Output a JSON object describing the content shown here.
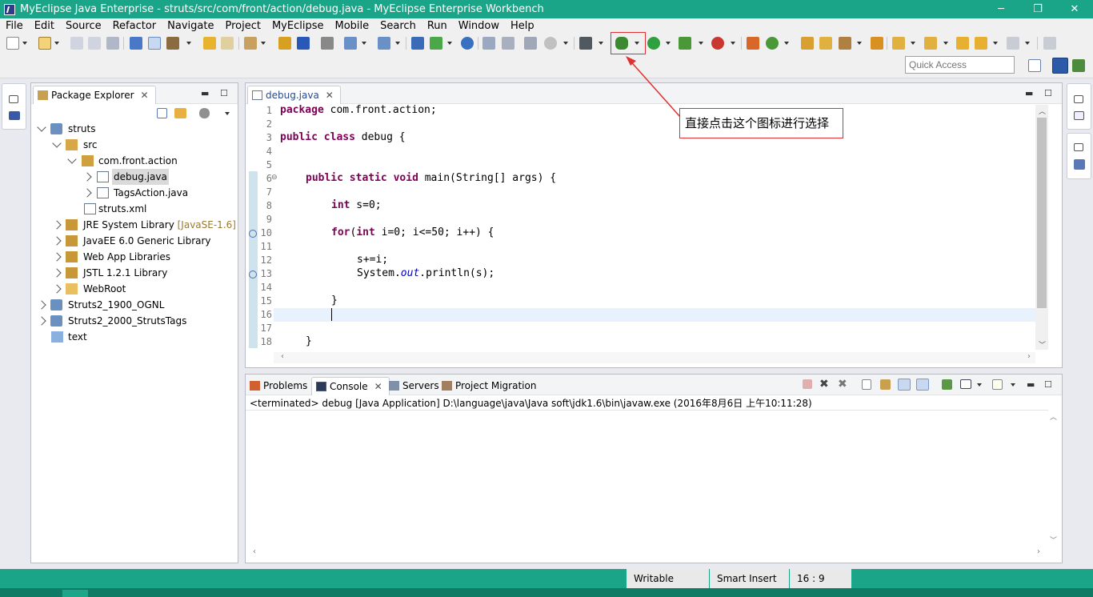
{
  "window": {
    "title": "MyEclipse Java Enterprise - struts/src/com/front/action/debug.java - MyEclipse Enterprise Workbench",
    "minimize": "─",
    "maximize": "❐",
    "close": "✕"
  },
  "menu": [
    "File",
    "Edit",
    "Source",
    "Refactor",
    "Navigate",
    "Project",
    "MyEclipse",
    "Mobile",
    "Search",
    "Run",
    "Window",
    "Help"
  ],
  "toolbar": {
    "quick_access_placeholder": "Quick Access"
  },
  "package_explorer": {
    "tab_label": "Package Explorer",
    "tree": [
      {
        "label": "struts",
        "icon": "project-icon"
      },
      {
        "label": "src",
        "icon": "source-folder-icon"
      },
      {
        "label": "com.front.action",
        "icon": "package-icon"
      },
      {
        "label": "debug.java",
        "icon": "java-file-icon"
      },
      {
        "label": "TagsAction.java",
        "icon": "java-file-icon"
      },
      {
        "label": "struts.xml",
        "icon": "xml-file-icon"
      },
      {
        "label": "JRE System Library",
        "decoration": "[JavaSE-1.6]",
        "icon": "library-icon"
      },
      {
        "label": "JavaEE 6.0 Generic Library",
        "icon": "library-icon"
      },
      {
        "label": "Web App Libraries",
        "icon": "library-icon"
      },
      {
        "label": "JSTL 1.2.1 Library",
        "icon": "library-icon"
      },
      {
        "label": "WebRoot",
        "icon": "folder-icon"
      },
      {
        "label": "Struts2_1900_OGNL",
        "icon": "project-icon"
      },
      {
        "label": "Struts2_2000_StrutsTags",
        "icon": "project-icon"
      },
      {
        "label": "text",
        "icon": "folder-icon"
      }
    ]
  },
  "editor": {
    "tab_label": "debug.java",
    "line_numbers": [
      "1",
      "2",
      "3",
      "4",
      "5",
      "6",
      "7",
      "8",
      "9",
      "10",
      "11",
      "12",
      "13",
      "14",
      "15",
      "16",
      "17",
      "18"
    ],
    "code": {
      "l1_kw": "package",
      "l1_rest": " com.front.action;",
      "l3_kw1": "public",
      "l3_kw2": "class",
      "l3_rest": " debug {",
      "l6_kw1": "public",
      "l6_kw2": "static",
      "l6_kw3": "void",
      "l6_rest": " main(String[] args) {",
      "l8_kw": "int",
      "l8_rest": " s=0;",
      "l10_kw1": "for",
      "l10_kw2": "int",
      "l10_rest": " i=0; i<=50; i++) {",
      "l10_paren": "(",
      "l12": "s+=i;",
      "l13_a": "System.",
      "l13_field": "out",
      "l13_b": ".println(s);",
      "l15": "}",
      "l18": "}"
    }
  },
  "console_view": {
    "tabs": [
      "Problems",
      "Console",
      "Servers",
      "Project Migration"
    ],
    "output": "<terminated> debug [Java Application] D:\\language\\java\\Java soft\\jdk1.6\\bin\\javaw.exe (2016年8月6日 上午10:11:28)"
  },
  "status_bar": {
    "writable": "Writable",
    "insert_mode": "Smart Insert",
    "position": "16 : 9"
  },
  "annotation": {
    "text": "直接点击这个图标进行选择"
  }
}
